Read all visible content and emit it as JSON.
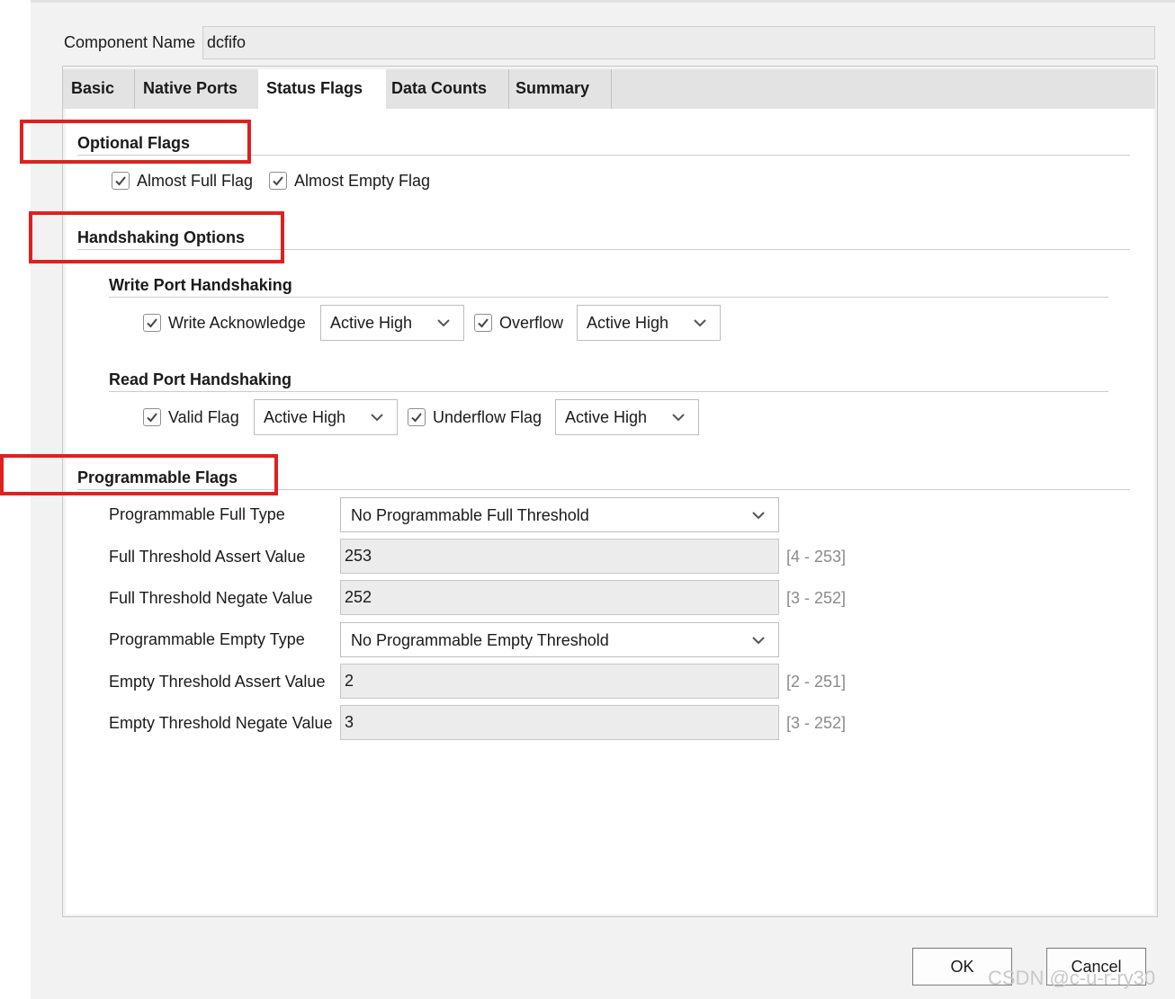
{
  "component": {
    "label": "Component Name",
    "value": "dcfifo"
  },
  "tabs": [
    {
      "label": "Basic"
    },
    {
      "label": "Native Ports"
    },
    {
      "label": "Status Flags",
      "active": true
    },
    {
      "label": "Data Counts"
    },
    {
      "label": "Summary"
    }
  ],
  "optional_flags": {
    "title": "Optional Flags",
    "almost_full": {
      "label": "Almost Full Flag",
      "checked": true
    },
    "almost_empty": {
      "label": "Almost Empty Flag",
      "checked": true
    }
  },
  "handshaking": {
    "title": "Handshaking Options",
    "write_port": {
      "title": "Write Port Handshaking",
      "write_ack": {
        "label": "Write Acknowledge",
        "checked": true,
        "value": "Active High"
      },
      "overflow": {
        "label": "Overflow",
        "checked": true,
        "value": "Active High"
      }
    },
    "read_port": {
      "title": "Read Port Handshaking",
      "valid": {
        "label": "Valid Flag",
        "checked": true,
        "value": "Active High"
      },
      "underflow": {
        "label": "Underflow Flag",
        "checked": true,
        "value": "Active High"
      }
    }
  },
  "programmable": {
    "title": "Programmable Flags",
    "full_type": {
      "label": "Programmable Full Type",
      "value": "No Programmable Full Threshold"
    },
    "full_assert": {
      "label": "Full Threshold Assert Value",
      "value": "253",
      "range": "[4 - 253]"
    },
    "full_negate": {
      "label": "Full Threshold Negate Value",
      "value": "252",
      "range": "[3 - 252]"
    },
    "empty_type": {
      "label": "Programmable Empty Type",
      "value": "No Programmable Empty Threshold"
    },
    "empty_assert": {
      "label": "Empty Threshold Assert Value",
      "value": "2",
      "range": "[2 - 251]"
    },
    "empty_negate": {
      "label": "Empty Threshold Negate Value",
      "value": "3",
      "range": "[3 - 252]"
    }
  },
  "buttons": {
    "ok": "OK",
    "cancel": "Cancel"
  },
  "watermark": "CSDN @c-u-r-ry30",
  "colors": {
    "highlight": "#e02020",
    "tab_bar": "#e3e3e3",
    "panel": "#f2f2f2"
  },
  "icons": {
    "checkbox": "check-icon",
    "dropdown": "chevron-down-icon"
  }
}
